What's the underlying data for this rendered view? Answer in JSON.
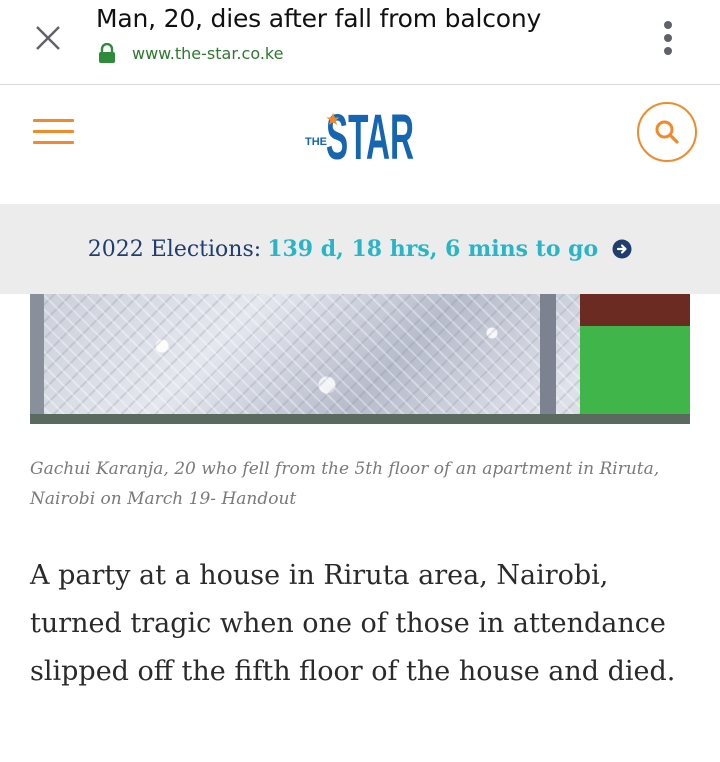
{
  "browser": {
    "title": "Man, 20, dies after fall from balcony",
    "url": "www.the-star.co.ke",
    "icons": {
      "close": "close-icon",
      "lock": "lock-icon",
      "menu": "more-vert-icon"
    }
  },
  "site_header": {
    "logo_small": "THE",
    "logo_main": "STAR",
    "icons": {
      "menu": "hamburger-icon",
      "search": "search-icon"
    },
    "accent_color": "#f28a2a",
    "logo_color": "#1565b0"
  },
  "election_banner": {
    "label": "2022 Elections:",
    "countdown": "139 d, 18 hrs, 6 mins to go",
    "icon": "arrow-right-circle-icon",
    "label_color": "#1f3d6e",
    "countdown_color": "#2ab5c7"
  },
  "article": {
    "caption": "Gachui Karanja, 20 who fell from the 5th floor of an apartment in Riruta, Nairobi on March 19- Handout",
    "body": "A party at a house in Riruta area, Nairobi, turned tragic when one of those in attendance slipped off the fifth floor of the house and died."
  }
}
